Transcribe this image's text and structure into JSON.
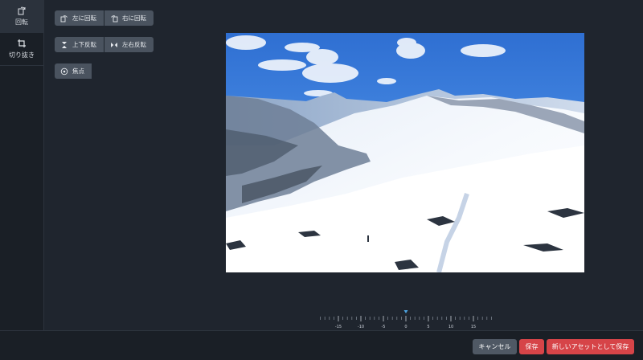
{
  "sidebar": {
    "items": [
      {
        "label": "回転",
        "icon": "rotate-icon",
        "active": true
      },
      {
        "label": "切り抜き",
        "icon": "crop-icon",
        "active": false
      }
    ]
  },
  "tools": {
    "rotate_left": "左に回転",
    "rotate_right": "右に回転",
    "flip_vertical": "上下反転",
    "flip_horizontal": "左右反転",
    "focus": "焦点"
  },
  "ruler": {
    "labels": [
      "-15",
      "-10",
      "-5",
      "0",
      "5",
      "10",
      "15"
    ],
    "current": 0
  },
  "footer": {
    "cancel": "キャンセル",
    "save": "保存",
    "save_as_new": "新しいアセットとして保存"
  },
  "colors": {
    "primary": "#d64448",
    "panel": "#1f252e",
    "button": "#4a535f",
    "indicator": "#4da3e0"
  }
}
